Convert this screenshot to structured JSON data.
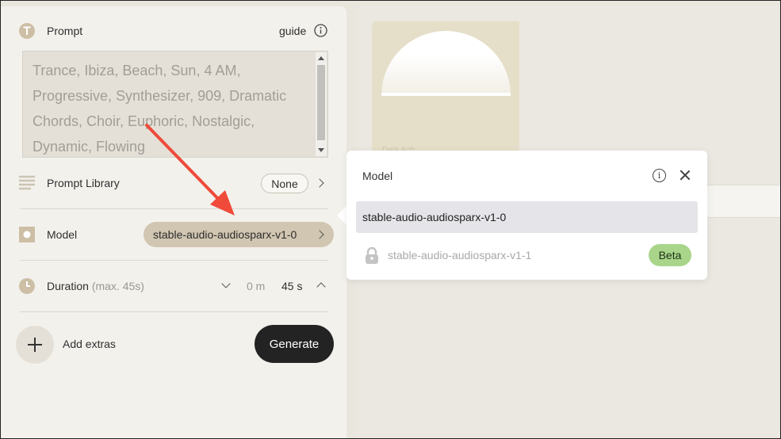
{
  "prompt": {
    "label": "Prompt",
    "guide_label": "guide",
    "text": "Trance, Ibiza, Beach, Sun, 4 AM, Progressive, Synthesizer, 909, Dramatic Chords, Choir, Euphoric, Nostalgic, Dynamic, Flowing"
  },
  "prompt_library": {
    "label": "Prompt Library",
    "value": "None"
  },
  "model": {
    "label": "Model",
    "value": "stable-audio-audiosparx-v1-0"
  },
  "duration": {
    "label": "Duration",
    "hint": "(max. 45s)",
    "minutes": "0 m",
    "seconds": "45 s"
  },
  "extras": {
    "label": "Add extras"
  },
  "generate": {
    "label": "Generate"
  },
  "card": {
    "caption": "Dark Aqfr"
  },
  "model_popover": {
    "title": "Model",
    "options": [
      {
        "label": "stable-audio-audiosparx-v1-0",
        "selected": true
      },
      {
        "label": "stable-audio-audiosparx-v1-1",
        "locked": true,
        "badge": "Beta"
      }
    ]
  },
  "colors": {
    "panel_bg": "#f3f1ec",
    "model_pill": "#d1c6b1",
    "generate_bg": "#232323",
    "beta_badge": "#a8d58a",
    "annotation_arrow": "#ef4a3a"
  }
}
